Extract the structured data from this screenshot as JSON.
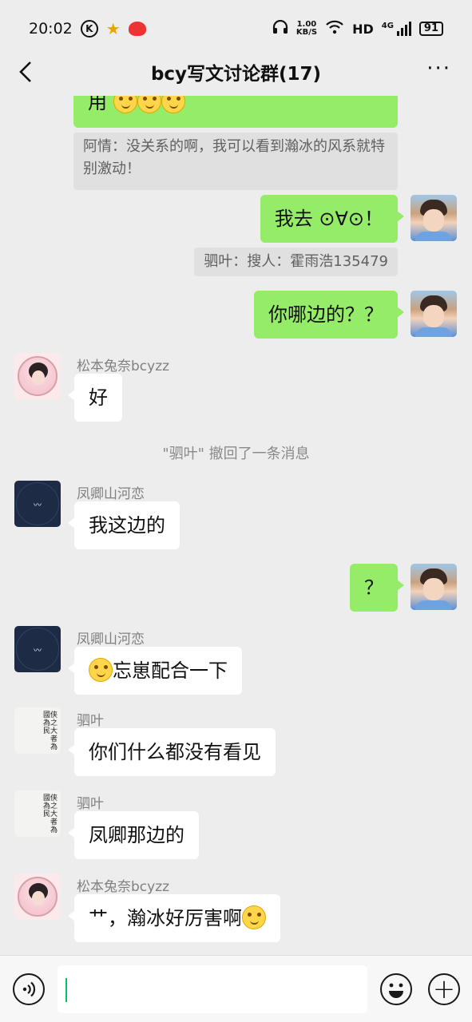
{
  "status_bar": {
    "time": "20:02",
    "k_icon": "K",
    "net_speed_value": "1.00",
    "net_speed_unit": "KB/S",
    "hd_label": "HD",
    "cell_label": "4G",
    "battery": "91"
  },
  "header": {
    "title": "bcy写文讨论群(17)",
    "back_icon": "chevron-left-icon",
    "more_icon": "more-dots-icon",
    "more_text": "···"
  },
  "messages": {
    "m1": {
      "text": "用"
    },
    "q1": {
      "text": "阿情：没关系的啊，我可以看到瀚冰的风系就特别激动！"
    },
    "m2": {
      "text": "我去 ⊙∀⊙！"
    },
    "q2": {
      "text": "驷叶：搜人：霍雨浩135479"
    },
    "m3": {
      "text": "你哪边的？？"
    },
    "m4": {
      "sender": "松本兔奈bcyzz",
      "text": "好"
    },
    "recall": {
      "text": "\"驷叶\" 撤回了一条消息"
    },
    "m5": {
      "sender": "凤卿山河恋",
      "text": "我这边的"
    },
    "m6": {
      "text": "？"
    },
    "m7": {
      "sender": "凤卿山河恋",
      "text": "忘崽配合一下"
    },
    "m8": {
      "sender": "驷叶",
      "text": "你们什么都没有看见"
    },
    "m9": {
      "sender": "驷叶",
      "text": "凤卿那边的"
    },
    "m10": {
      "sender": "松本兔奈bcyzz",
      "text": "艹，瀚冰好厉害啊"
    }
  },
  "input_bar": {
    "voice_icon": "voice-icon",
    "emoji_icon": "emoji-icon",
    "plus_icon": "plus-icon",
    "plus_text": "+"
  },
  "colors": {
    "background": "#ededed",
    "my_bubble": "#95ec69",
    "other_bubble": "#ffffff",
    "caret": "#07c160"
  }
}
